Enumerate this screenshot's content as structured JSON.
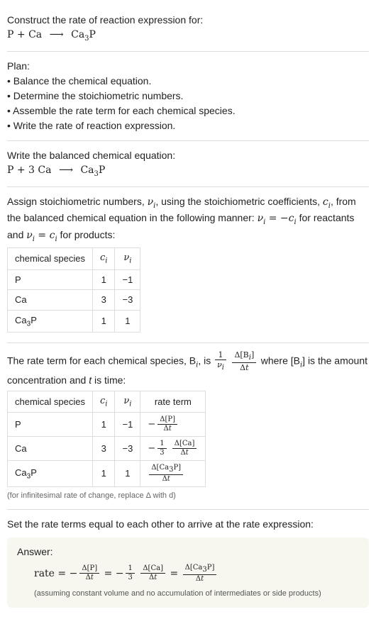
{
  "prompt": {
    "title": "Construct the rate of reaction expression for:",
    "equation": "P + Ca  ⟶  Ca3P",
    "eq_left1": "P",
    "eq_plus": " + ",
    "eq_left2": "Ca",
    "eq_arrow": "⟶",
    "eq_right": "Ca3P"
  },
  "plan": {
    "title": "Plan:",
    "b1": "• Balance the chemical equation.",
    "b2": "• Determine the stoichiometric numbers.",
    "b3": "• Assemble the rate term for each chemical species.",
    "b4": "• Write the rate of reaction expression."
  },
  "balanced": {
    "title": "Write the balanced chemical equation:",
    "eq_left1": "P",
    "eq_plus": " + 3 ",
    "eq_left2": "Ca",
    "eq_arrow": "⟶",
    "eq_right": "Ca3P"
  },
  "assign": {
    "text_a": "Assign stoichiometric numbers, ",
    "nu_i": "νi",
    "text_b": ", using the stoichiometric coefficients, ",
    "c_i": "ci",
    "text_c": ", from the balanced chemical equation in the following manner: ",
    "eq1": "νi = −ci",
    "text_d": " for reactants and ",
    "eq2": "νi = ci",
    "text_e": " for products:",
    "table": {
      "h1": "chemical species",
      "h2": "ci",
      "h3": "νi",
      "rows": [
        {
          "sp": "P",
          "c": "1",
          "nu": "−1"
        },
        {
          "sp": "Ca",
          "c": "3",
          "nu": "−3"
        },
        {
          "sp": "Ca3P",
          "c": "1",
          "nu": "1"
        }
      ]
    }
  },
  "rateterm": {
    "text_a": "The rate term for each chemical species, B",
    "text_b": ", is ",
    "text_c": " where [B",
    "text_d": "] is the amount concentration and ",
    "t_var": "t",
    "text_e": " is time:",
    "table": {
      "h1": "chemical species",
      "h2": "ci",
      "h3": "νi",
      "h4": "rate term",
      "rows": [
        {
          "sp": "P",
          "c": "1",
          "nu": "−1"
        },
        {
          "sp": "Ca",
          "c": "3",
          "nu": "−3"
        },
        {
          "sp": "Ca3P",
          "c": "1",
          "nu": "1"
        }
      ]
    },
    "note": "(for infinitesimal rate of change, replace Δ with d)"
  },
  "setequal": {
    "text": "Set the rate terms equal to each other to arrive at the rate expression:"
  },
  "answer": {
    "title": "Answer:",
    "rate_label": "rate = ",
    "equals": " = ",
    "onethird": "1/3",
    "note": "(assuming constant volume and no accumulation of intermediates or side products)"
  },
  "symbols": {
    "nu": "ν",
    "i": "i",
    "Delta": "Δ",
    "Bi": "Bi",
    "t": "t",
    "P": "P",
    "Ca": "Ca",
    "Ca3P": "Ca3P",
    "three": "3",
    "one": "1",
    "neg": "−",
    "sub3": "3"
  },
  "chart_data": {
    "type": "table",
    "title": "Rate of reaction derivation",
    "balanced_equation": "P + 3 Ca ⟶ Ca3P",
    "stoichiometry": [
      {
        "species": "P",
        "c_i": 1,
        "nu_i": -1
      },
      {
        "species": "Ca",
        "c_i": 3,
        "nu_i": -3
      },
      {
        "species": "Ca3P",
        "c_i": 1,
        "nu_i": 1
      }
    ],
    "rate_terms": [
      {
        "species": "P",
        "expression": "-Δ[P]/Δt"
      },
      {
        "species": "Ca",
        "expression": "-(1/3) Δ[Ca]/Δt"
      },
      {
        "species": "Ca3P",
        "expression": "Δ[Ca3P]/Δt"
      }
    ],
    "rate_expression": "rate = -Δ[P]/Δt = -(1/3) Δ[Ca]/Δt = Δ[Ca3P]/Δt"
  }
}
